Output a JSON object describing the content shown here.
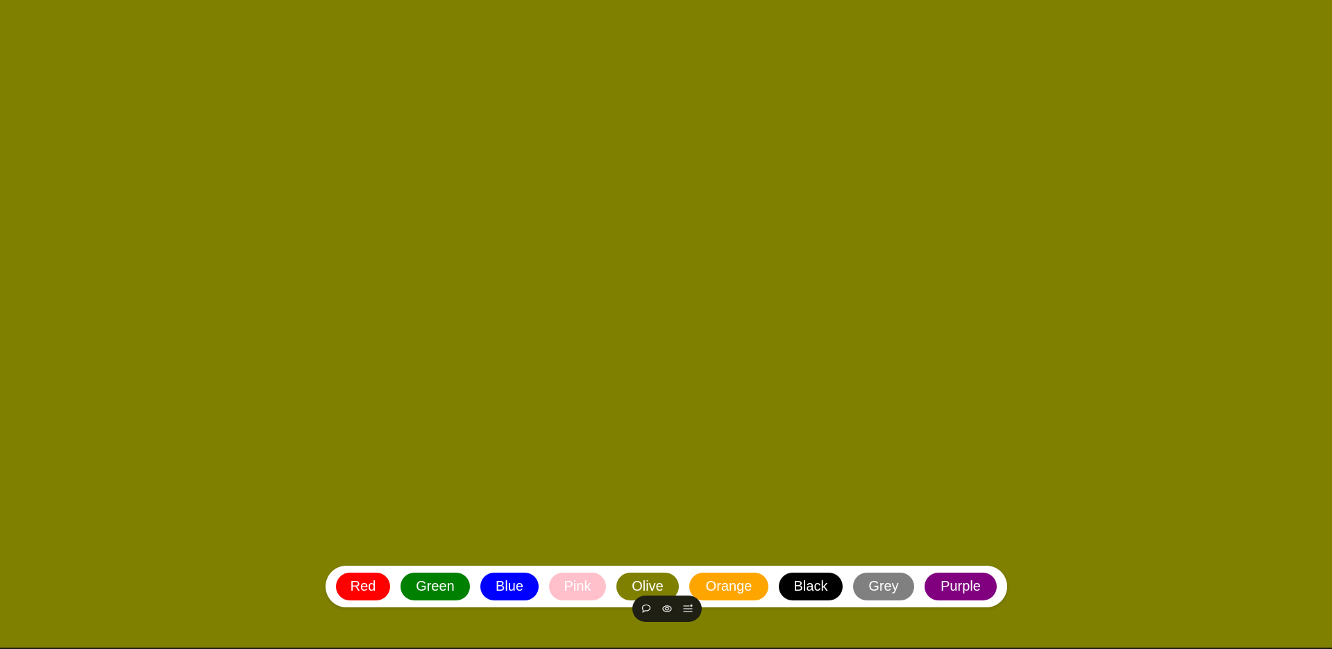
{
  "page": {
    "background_color": "#808000"
  },
  "color_bar": {
    "swatches": [
      {
        "label": "Red",
        "bg": "#ff0000",
        "fg": "#ffffff"
      },
      {
        "label": "Green",
        "bg": "#008000",
        "fg": "#ffffff"
      },
      {
        "label": "Blue",
        "bg": "#0000ff",
        "fg": "#ffffff"
      },
      {
        "label": "Pink",
        "bg": "#ffc0cb",
        "fg": "#ffffff"
      },
      {
        "label": "Olive",
        "bg": "#808000",
        "fg": "#ffffff"
      },
      {
        "label": "Orange",
        "bg": "#ffa500",
        "fg": "#ffffff"
      },
      {
        "label": "Black",
        "bg": "#000000",
        "fg": "#ffffff"
      },
      {
        "label": "Grey",
        "bg": "#808080",
        "fg": "#ffffff"
      },
      {
        "label": "Purple",
        "bg": "#800080",
        "fg": "#ffffff"
      }
    ]
  },
  "mini_toolbar": {
    "icons": [
      "comment-icon",
      "view-icon",
      "menu-icon"
    ],
    "icon_color": "#e6e6e6"
  }
}
